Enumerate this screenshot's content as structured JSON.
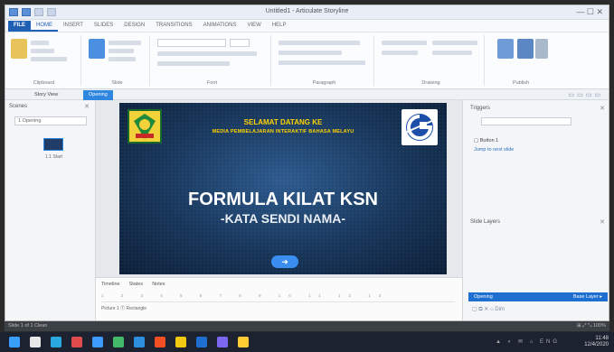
{
  "window": {
    "title": "Untitled1 - Articulate Storyline",
    "controls": "— ☐ ✕"
  },
  "ribbon_tabs": [
    "FILE",
    "HOME",
    "INSERT",
    "SLIDES",
    "DESIGN",
    "TRANSITIONS",
    "ANIMATIONS",
    "VIEW",
    "HELP"
  ],
  "ribbon_groups": [
    "Clipboard",
    "Slide",
    "Font",
    "Paragraph",
    "Drawing",
    "Publish"
  ],
  "view_tabs": {
    "story_view": "Story View",
    "slide_tab": "Opening"
  },
  "left_panel": {
    "title": "Scenes",
    "dropdown": "1 Opening",
    "thumb_label": "1.1 Start"
  },
  "slide": {
    "welcome": "SELAMAT DATANG KE",
    "sub": "MEDIA PEMBELAJARAN INTERAKTIF BAHASA MELAYU",
    "title": "FORMULA KILAT KSN",
    "subtitle": "-KATA SENDI NAMA-",
    "next_button": "➜"
  },
  "timeline": {
    "tabs": [
      "Timeline",
      "States",
      "Notes"
    ],
    "ruler": "1 2 3 4 5 6 7 8 9 10 11 12 13",
    "row_label": "Picture 1   Ⓣ Rectangle"
  },
  "right_panel": {
    "triggers_title": "Triggers",
    "trigger_item": "▢ Button 1",
    "trigger_link": "Jump to next slide",
    "layers_title": "Slide Layers",
    "base_layer": "Opening",
    "base_layer_right": "Base Layer ▸",
    "layer_tools": "▢ ⧉ ✕   ⌂ Dim"
  },
  "status": {
    "left": "Slide 1 of 1   Clean",
    "right": "⊞ ⤢ ⤡ 100%"
  },
  "taskbar": {
    "icons": [
      "#3aa0ff",
      "#e8e8e8",
      "#2aa8e0",
      "#e24b4b",
      "#3d9bff",
      "#44b96a",
      "#2d8fdc",
      "#f25022",
      "#f2c811",
      "#1f6fd1",
      "#7b68ee",
      "#ffcc33"
    ],
    "tray": "▲ ◐ ✉ ⌂ ENG",
    "time": "11:48",
    "date": "12/4/2020"
  }
}
